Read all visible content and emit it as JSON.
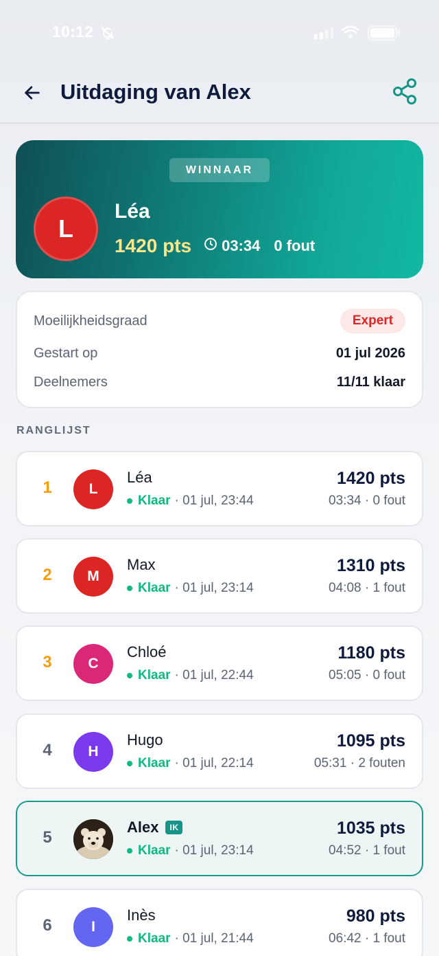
{
  "status_bar": {
    "time": "10:12"
  },
  "header": {
    "title": "Uitdaging van Alex"
  },
  "winner": {
    "badge": "WINNAAR",
    "initial": "L",
    "name": "Léa",
    "points": "1420 pts",
    "time": "03:34",
    "errors": "0 fout",
    "avatar_color": "#dc2626"
  },
  "info": {
    "difficulty_label": "Moeilijkheidsgraad",
    "difficulty_value": "Expert",
    "started_label": "Gestart op",
    "started_value": "01 jul 2026",
    "participants_label": "Deelnemers",
    "participants_value": "11/11 klaar"
  },
  "ranking": {
    "title": "RANGLIJST",
    "items": [
      {
        "rank": "1",
        "initial": "L",
        "name": "Léa",
        "status": "Klaar",
        "time_stamp": "· 01 jul, 23:44",
        "points": "1420 pts",
        "sub": "03:34 · 0 fout",
        "color": "#dc2626"
      },
      {
        "rank": "2",
        "initial": "M",
        "name": "Max",
        "status": "Klaar",
        "time_stamp": "· 01 jul, 23:14",
        "points": "1310 pts",
        "sub": "04:08 · 1 fout",
        "color": "#dc2626"
      },
      {
        "rank": "3",
        "initial": "C",
        "name": "Chloé",
        "status": "Klaar",
        "time_stamp": "· 01 jul, 22:44",
        "points": "1180 pts",
        "sub": "05:05 · 0 fout",
        "color": "#db2777"
      },
      {
        "rank": "4",
        "initial": "H",
        "name": "Hugo",
        "status": "Klaar",
        "time_stamp": "· 01 jul, 22:14",
        "points": "1095 pts",
        "sub": "05:31 · 2 fouten",
        "color": "#7c3aed"
      },
      {
        "rank": "5",
        "initial": "",
        "name": "Alex",
        "me_badge": "IK",
        "status": "Klaar",
        "time_stamp": "· 01 jul, 23:14",
        "points": "1035 pts",
        "sub": "04:52 · 1 fout",
        "color": "#3a2e22"
      },
      {
        "rank": "6",
        "initial": "I",
        "name": "Inès",
        "status": "Klaar",
        "time_stamp": "· 01 jul, 21:44",
        "points": "980 pts",
        "sub": "06:42 · 1 fout",
        "color": "#6366f1"
      }
    ]
  }
}
